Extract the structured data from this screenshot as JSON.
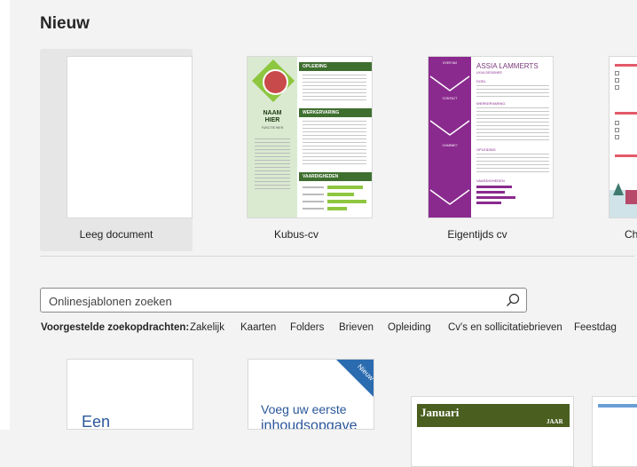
{
  "section_title": "Nieuw",
  "templates": [
    {
      "label": "Leeg document"
    },
    {
      "label": "Kubus-cv"
    },
    {
      "label": "Eigentijds cv"
    },
    {
      "label": "Ch"
    }
  ],
  "kubus_cv": {
    "name_line1": "NAAM",
    "name_line2": "HIER",
    "role": "FUNCTIE HIER",
    "section_opleiding": "OPLEIDING",
    "section_werkervaring": "WERKERVARING",
    "section_vaardigheden": "VAARDIGHEDEN",
    "accent_color": "#3f6f2f"
  },
  "eigentijds_cv": {
    "name": "ASSIA LAMMERTS",
    "role": "UX/UI-DESIGNER",
    "over_mij": "OVER MIJ",
    "contact": "CONTACT",
    "hobby": "CHARME?",
    "doel": "DOEL",
    "werkervaring": "WERKERVARING",
    "opleiding": "OPLEIDING",
    "vaardigheden": "VAARDIGHEDEN",
    "accent_color": "#8a2a8e"
  },
  "search": {
    "placeholder": "Onlinesjablonen zoeken"
  },
  "suggestions": {
    "label": "Voorgestelde zoekopdrachten:",
    "items": [
      "Zakelijk",
      "Kaarten",
      "Folders",
      "Brieven",
      "Opleiding",
      "Cv's en sollicitatiebrieven",
      "Feestdag"
    ]
  },
  "cards": {
    "card1_text": "Een",
    "card2_line1": "Voeg uw eerste",
    "card2_line2": "inhoudsopgave",
    "card2_badge": "Nieuw",
    "card3_month": "Januari",
    "card3_year": "JAAR"
  }
}
